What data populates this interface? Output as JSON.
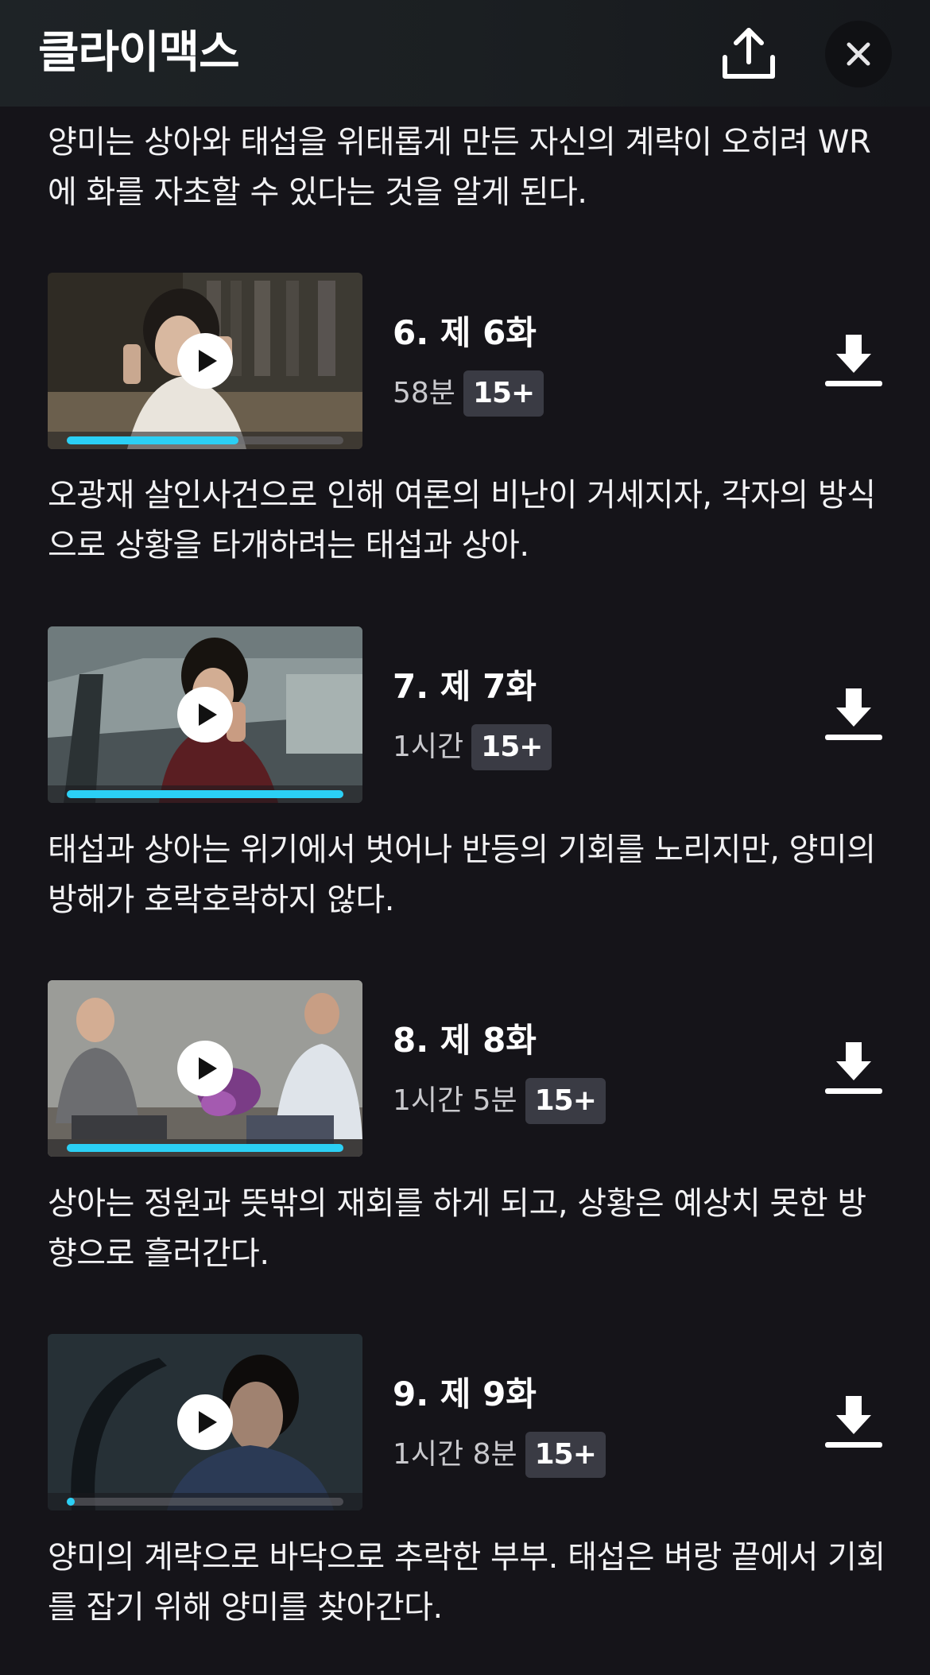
{
  "header": {
    "title": "클라이맥스"
  },
  "intro_description": "양미는 상아와 태섭을 위태롭게 만든 자신의 계략이 오히려 WR에 화를 자초할 수 있다는 것을 알게 된다.",
  "episodes": [
    {
      "title": "6. 제 6화",
      "duration": "58분",
      "rating": "15+",
      "progress": 0.62,
      "description": "오광재 살인사건으로 인해 여론의 비난이 거세지자, 각자의 방식으로 상황을 타개하려는 태섭과 상아."
    },
    {
      "title": "7. 제 7화",
      "duration": "1시간",
      "rating": "15+",
      "progress": 1.0,
      "description": "태섭과 상아는 위기에서 벗어나 반등의 기회를 노리지만, 양미의 방해가 호락호락하지 않다."
    },
    {
      "title": "8. 제 8화",
      "duration": "1시간 5분",
      "rating": "15+",
      "progress": 1.0,
      "description": "상아는 정원과 뜻밖의 재회를 하게 되고, 상황은 예상치 못한 방향으로 흘러간다."
    },
    {
      "title": "9. 제 9화",
      "duration": "1시간 8분",
      "rating": "15+",
      "progress": 0.02,
      "description": "양미의 계략으로 바닥으로 추락한 부부. 태섭은 벼랑 끝에서 기회를 잡기 위해 양미를 찾아간다."
    }
  ],
  "icons": {
    "share": "share-upload-icon",
    "close": "close-icon",
    "play": "play-icon",
    "download": "download-icon"
  },
  "colors": {
    "background": "#151419",
    "progress": "#2bd0f5",
    "badge": "#3a3b44"
  }
}
